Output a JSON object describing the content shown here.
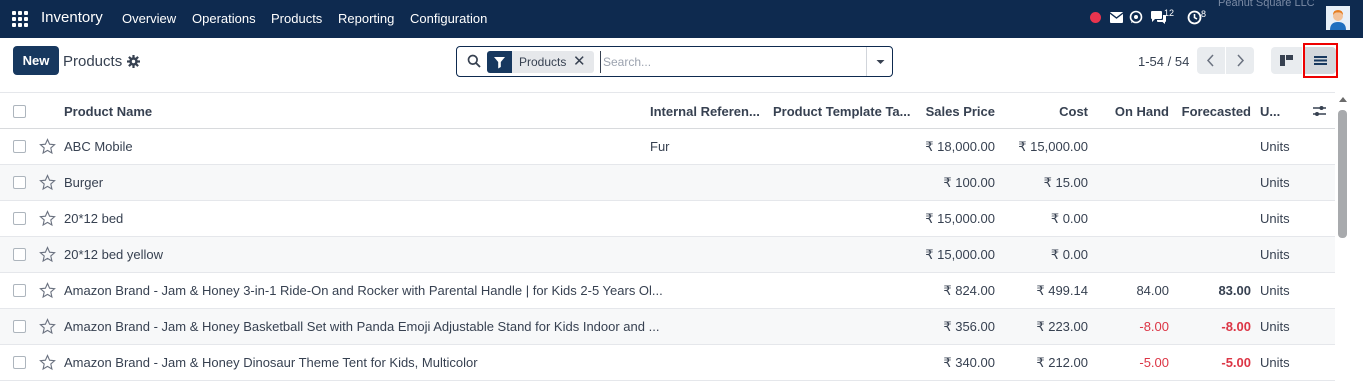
{
  "navbar": {
    "brand": "Inventory",
    "menu": [
      "Overview",
      "Operations",
      "Products",
      "Reporting",
      "Configuration"
    ],
    "company": "Peanut Square LLC",
    "messages_badge": "12",
    "activity_badge": "8"
  },
  "control": {
    "new_label": "New",
    "breadcrumb": "Products",
    "facet": "Products",
    "search_placeholder": "Search...",
    "pager": "1-54 / 54"
  },
  "table": {
    "headers": {
      "name": "Product Name",
      "ref": "Internal Referen...",
      "tags": "Product Template Ta...",
      "price": "Sales Price",
      "cost": "Cost",
      "onhand": "On Hand",
      "forecast": "Forecasted",
      "uom": "U..."
    },
    "rows": [
      {
        "name": "ABC Mobile",
        "ref": "Fur",
        "price": "₹ 18,000.00",
        "cost": "₹ 15,000.00",
        "onhand": "",
        "forecast": "",
        "uom": "Units"
      },
      {
        "name": "Burger",
        "ref": "",
        "price": "₹ 100.00",
        "cost": "₹ 15.00",
        "onhand": "",
        "forecast": "",
        "uom": "Units"
      },
      {
        "name": "20*12 bed",
        "ref": "",
        "price": "₹ 15,000.00",
        "cost": "₹ 0.00",
        "onhand": "",
        "forecast": "",
        "uom": "Units"
      },
      {
        "name": "20*12 bed yellow",
        "ref": "",
        "price": "₹ 15,000.00",
        "cost": "₹ 0.00",
        "onhand": "",
        "forecast": "",
        "uom": "Units"
      },
      {
        "name": "Amazon Brand - Jam & Honey 3-in-1 Ride-On and Rocker with Parental Handle | for Kids 2-5 Years Ol...",
        "ref": "",
        "price": "₹ 824.00",
        "cost": "₹ 499.14",
        "onhand": "84.00",
        "forecast": "83.00",
        "uom": "Units"
      },
      {
        "name": "Amazon Brand - Jam & Honey Basketball Set with Panda Emoji Adjustable Stand for Kids Indoor and ...",
        "ref": "",
        "price": "₹ 356.00",
        "cost": "₹ 223.00",
        "onhand": "-8.00",
        "forecast": "-8.00",
        "uom": "Units"
      },
      {
        "name": "Amazon Brand - Jam & Honey Dinosaur Theme Tent for Kids, Multicolor",
        "ref": "",
        "price": "₹ 340.00",
        "cost": "₹ 212.00",
        "onhand": "-5.00",
        "forecast": "-5.00",
        "uom": "Units"
      }
    ]
  },
  "colors": {
    "navbar": "#0e2a4f",
    "primary": "#17385f",
    "negative": "#dc3545",
    "highlight": "#e00000"
  }
}
